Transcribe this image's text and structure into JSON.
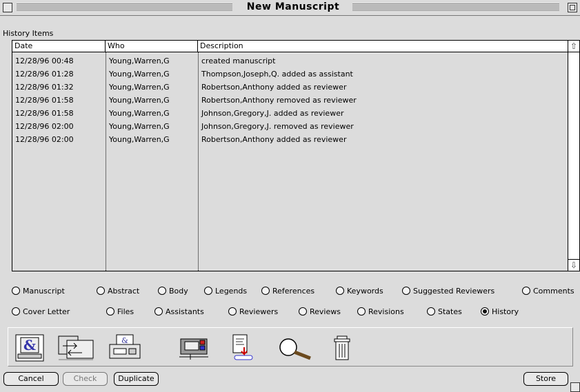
{
  "window": {
    "title": "New Manuscript"
  },
  "history": {
    "label": "History Items",
    "columns": [
      "Date",
      "Who",
      "Description"
    ],
    "rows": [
      [
        "12/28/96 00:48",
        "Young,Warren,G",
        "created manuscript"
      ],
      [
        "12/28/96 01:28",
        "Young,Warren,G",
        "Thompson,Joseph,Q. added as assistant"
      ],
      [
        "12/28/96 01:32",
        "Young,Warren,G",
        "Robertson,Anthony added as reviewer"
      ],
      [
        "12/28/96 01:58",
        "Young,Warren,G",
        "Robertson,Anthony removed as reviewer"
      ],
      [
        "12/28/96 01:58",
        "Young,Warren,G",
        "Johnson,Gregory,J. added as reviewer"
      ],
      [
        "12/28/96 02:00",
        "Young,Warren,G",
        "Johnson,Gregory,J. removed as reviewer"
      ],
      [
        "12/28/96 02:00",
        "Young,Warren,G",
        "Robertson,Anthony added as reviewer"
      ]
    ]
  },
  "tabs_row1": [
    "Manuscript",
    "Abstract",
    "Body",
    "Legends",
    "References",
    "Keywords",
    "Suggested Reviewers",
    "Comments"
  ],
  "tabs_row2": [
    "Cover Letter",
    "Files",
    "Assistants",
    "Reviewers",
    "Reviews",
    "Revisions",
    "States",
    "History"
  ],
  "selected_tab": "History",
  "toolbar_icons": [
    "letter-icon",
    "transfer-icon",
    "printer-icon",
    "fax-icon",
    "export-document-icon",
    "magnifier-icon",
    "trash-icon"
  ],
  "buttons": {
    "cancel": "Cancel",
    "check": "Check",
    "duplicate": "Duplicate",
    "store": "Store"
  }
}
